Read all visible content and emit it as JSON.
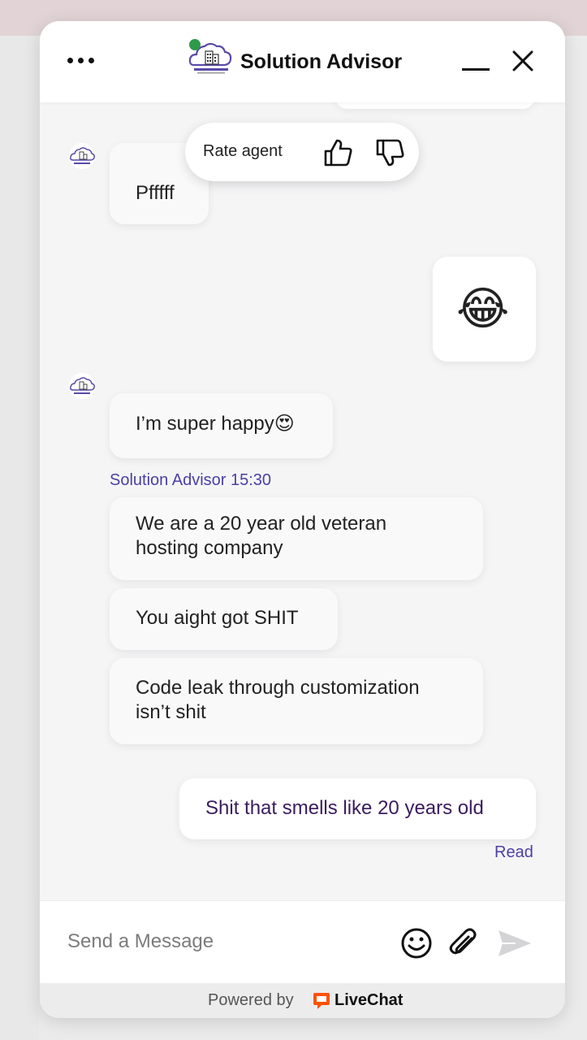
{
  "header": {
    "agent_name": "Solution Advisor",
    "status": "online",
    "menu_icon": "more-horizontal-icon",
    "minimize_icon": "minimize-icon",
    "close_icon": "close-icon"
  },
  "rate_popup": {
    "label": "Rate agent",
    "thumbs_up_icon": "thumbs-up-icon",
    "thumbs_down_icon": "thumbs-down-icon"
  },
  "messages": [
    {
      "from": "agent",
      "text": "Pfffff"
    },
    {
      "from": "visitor",
      "text": "😂"
    },
    {
      "from": "agent",
      "text": "I’m super happy😍"
    },
    {
      "from": "agent",
      "meta": "Solution Advisor 15:30",
      "lines": [
        "We are a 20 year old veteran",
        "hosting company"
      ]
    },
    {
      "from": "agent",
      "text": "You aight got SHIT"
    },
    {
      "from": "agent",
      "lines": [
        "Code leak through customization",
        "isn’t shit"
      ]
    },
    {
      "from": "visitor",
      "text": "Shit that smells like 20 years old",
      "receipt": "Read"
    }
  ],
  "composer": {
    "placeholder": "Send a Message",
    "value": "",
    "emoji_icon": "smiley-icon",
    "attach_icon": "paperclip-icon",
    "send_icon": "send-icon"
  },
  "footer": {
    "powered_by": "Powered by",
    "brand": "LiveChat"
  },
  "colors": {
    "accent": "#4b3fa6",
    "own_message_text": "#3a1c5e",
    "online": "#2f9a4a",
    "livechat_orange": "#ff5100"
  }
}
